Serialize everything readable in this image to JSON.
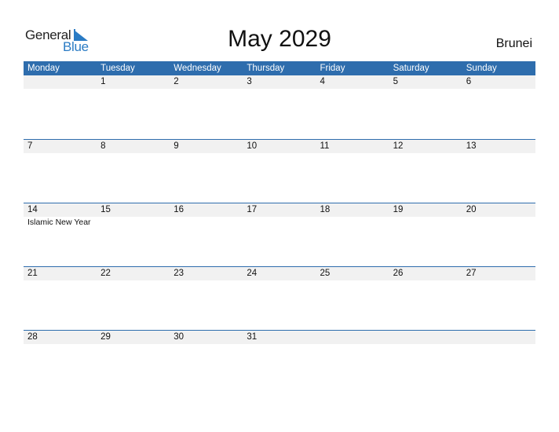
{
  "logo": {
    "line1": "General",
    "line2": "Blue"
  },
  "title": "May 2029",
  "country": "Brunei",
  "colors": {
    "header_bg": "#2e6dad",
    "strip_bg": "#f1f1f1",
    "brand_blue": "#2a7bc4"
  },
  "weekdays": [
    "Monday",
    "Tuesday",
    "Wednesday",
    "Thursday",
    "Friday",
    "Saturday",
    "Sunday"
  ],
  "weeks": [
    {
      "days": [
        "",
        "1",
        "2",
        "3",
        "4",
        "5",
        "6"
      ],
      "events": [
        "",
        "",
        "",
        "",
        "",
        "",
        ""
      ]
    },
    {
      "days": [
        "7",
        "8",
        "9",
        "10",
        "11",
        "12",
        "13"
      ],
      "events": [
        "",
        "",
        "",
        "",
        "",
        "",
        ""
      ]
    },
    {
      "days": [
        "14",
        "15",
        "16",
        "17",
        "18",
        "19",
        "20"
      ],
      "events": [
        "Islamic New Year",
        "",
        "",
        "",
        "",
        "",
        ""
      ]
    },
    {
      "days": [
        "21",
        "22",
        "23",
        "24",
        "25",
        "26",
        "27"
      ],
      "events": [
        "",
        "",
        "",
        "",
        "",
        "",
        ""
      ]
    },
    {
      "days": [
        "28",
        "29",
        "30",
        "31",
        "",
        "",
        ""
      ],
      "events": [
        "",
        "",
        "",
        "",
        "",
        "",
        ""
      ]
    }
  ]
}
